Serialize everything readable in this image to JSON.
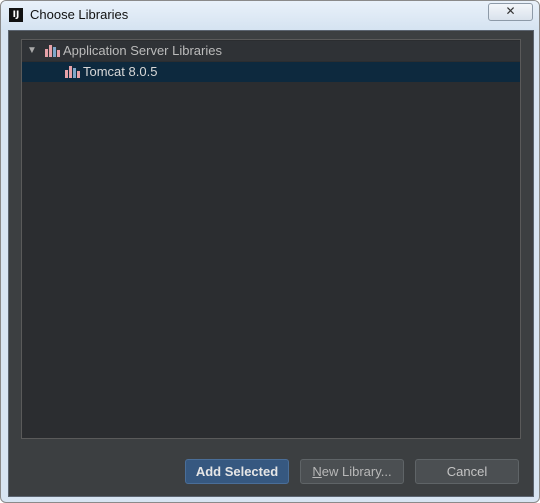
{
  "window": {
    "title": "Choose Libraries",
    "app_icon_label": "IJ",
    "close_glyph": "✕"
  },
  "tree": {
    "root": {
      "expand_glyph": "▼",
      "label": "Application Server Libraries",
      "icon": "library-icon",
      "expanded": true
    },
    "children": [
      {
        "label": "Tomcat 8.0.5",
        "icon": "library-icon",
        "selected": true
      }
    ]
  },
  "buttons": {
    "add_selected": "Add Selected",
    "new_library_mnemonic": "N",
    "new_library_rest": "ew Library...",
    "cancel": "Cancel"
  },
  "colors": {
    "panel_bg": "#3c3f41",
    "tree_bg": "#2b2d30",
    "selection_bg": "#0d293e",
    "default_button": "#365880",
    "library_icon_pink": "#e6a1a8",
    "library_icon_blue": "#7fa6c9"
  }
}
